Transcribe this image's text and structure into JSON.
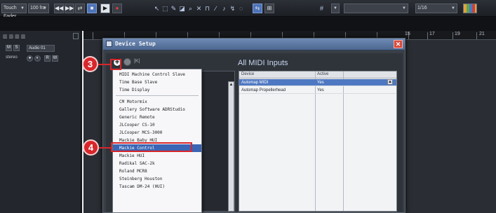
{
  "toolbar": {
    "snap_mode": "Touch Fader",
    "tempo": "100 fra",
    "grid_value": "1/16",
    "colors": {
      "accent": "#4e78c2",
      "callout": "#d8262b"
    }
  },
  "track": {
    "name": "Audio 01",
    "type": "stereo"
  },
  "ruler": {
    "bars": [
      "15",
      "17",
      "19",
      "21"
    ]
  },
  "dialog": {
    "title": "Device Setup",
    "reset_label": "|K|",
    "section_title": "All MIDI Inputs",
    "columns": [
      "Device",
      "Active"
    ],
    "rows": [
      {
        "device": "Automap MIDI",
        "active": "Yes",
        "selected": true
      },
      {
        "device": "Automap Propellerhead",
        "active": "Yes",
        "selected": false
      }
    ]
  },
  "menu": {
    "items": [
      "MIDI Machine Control Slave",
      "Time Base Slave",
      "Time Display",
      "CM Motormix",
      "Gallery Software ADRStudio",
      "Generic Remote",
      "JLCooper CS-10",
      "JLCooper MCS-3000",
      "Mackie Baby HUI",
      "Mackie Control",
      "Mackie HUI",
      "Radikal SAC-2k",
      "Roland MCR8",
      "Steinberg Houston",
      "Tascam DM-24 (HUI)"
    ],
    "highlighted": "Mackie Control"
  },
  "callouts": [
    "3",
    "4"
  ]
}
